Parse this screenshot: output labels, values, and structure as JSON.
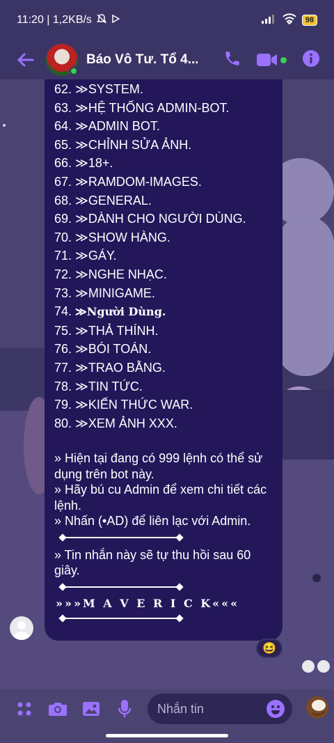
{
  "status_bar": {
    "time_speed": "11:20 | 1,2KB/s",
    "battery": "98"
  },
  "header": {
    "title": "Báo Vô Tư. Tổ 4...",
    "back_icon": "arrow-left-icon",
    "call_icon": "phone-icon",
    "video_icon": "video-camera-icon",
    "info_icon": "info-icon",
    "accent_color": "#9a72ff"
  },
  "message": {
    "commands": [
      "62. ≫SYSTEM.",
      "63. ≫HỆ THỐNG ADMIN-BOT.",
      "64. ≫ADMIN BOT.",
      "65. ≫CHỈNH SỬA ẢNH.",
      "66. ≫18+.",
      "67. ≫RAMDOM-IMAGES.",
      "68. ≫GENERAL.",
      "69. ≫DÀNH CHO NGƯỜI DÙNG.",
      "70. ≫SHOW HÀNG.",
      "71. ≫GÁY.",
      "72. ≫NGHE NHẠC.",
      "73. ≫MINIGAME.",
      "≫Người Dùng.",
      "75. ≫THẢ THÍNH.",
      "76. ≫BÓI TOÁN.",
      "77. ≫TRAO BẰNG.",
      "78. ≫TIN TỨC.",
      "79. ≫KIẾN THỨC WAR.",
      "80. ≫XEM ẢNH XXX."
    ],
    "cmd74_num": "74. ",
    "info_lines": [
      "» Hiện tại đang có 999 lệnh có thể sử dụng trên bot này.",
      "» Hãy bú cu Admin để xem chi tiết các lệnh.",
      "» Nhấn (•AD) để liên lạc với Admin."
    ],
    "recall_notice": "» Tin nhắn này sẽ tự thu hồi sau 60 giây.",
    "signature": "»»»M A V E R I C K«««",
    "reaction": "😆",
    "bubble_color": "#23175a"
  },
  "composer": {
    "placeholder": "Nhắn tin",
    "icons": [
      "apps-icon",
      "camera-icon",
      "image-icon",
      "microphone-icon",
      "emoji-icon",
      "coconut-icon"
    ]
  }
}
